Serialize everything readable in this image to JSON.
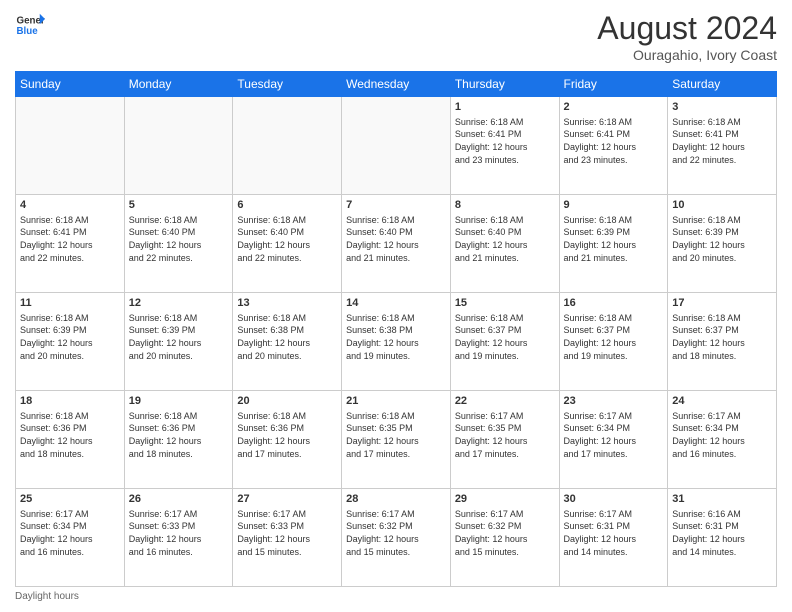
{
  "header": {
    "logo_general": "General",
    "logo_blue": "Blue",
    "title": "August 2024",
    "subtitle": "Ouragahio, Ivory Coast"
  },
  "footer": {
    "note": "Daylight hours"
  },
  "weekdays": [
    "Sunday",
    "Monday",
    "Tuesday",
    "Wednesday",
    "Thursday",
    "Friday",
    "Saturday"
  ],
  "weeks": [
    [
      {
        "day": "",
        "info": ""
      },
      {
        "day": "",
        "info": ""
      },
      {
        "day": "",
        "info": ""
      },
      {
        "day": "",
        "info": ""
      },
      {
        "day": "1",
        "info": "Sunrise: 6:18 AM\nSunset: 6:41 PM\nDaylight: 12 hours\nand 23 minutes."
      },
      {
        "day": "2",
        "info": "Sunrise: 6:18 AM\nSunset: 6:41 PM\nDaylight: 12 hours\nand 23 minutes."
      },
      {
        "day": "3",
        "info": "Sunrise: 6:18 AM\nSunset: 6:41 PM\nDaylight: 12 hours\nand 22 minutes."
      }
    ],
    [
      {
        "day": "4",
        "info": "Sunrise: 6:18 AM\nSunset: 6:41 PM\nDaylight: 12 hours\nand 22 minutes."
      },
      {
        "day": "5",
        "info": "Sunrise: 6:18 AM\nSunset: 6:40 PM\nDaylight: 12 hours\nand 22 minutes."
      },
      {
        "day": "6",
        "info": "Sunrise: 6:18 AM\nSunset: 6:40 PM\nDaylight: 12 hours\nand 22 minutes."
      },
      {
        "day": "7",
        "info": "Sunrise: 6:18 AM\nSunset: 6:40 PM\nDaylight: 12 hours\nand 21 minutes."
      },
      {
        "day": "8",
        "info": "Sunrise: 6:18 AM\nSunset: 6:40 PM\nDaylight: 12 hours\nand 21 minutes."
      },
      {
        "day": "9",
        "info": "Sunrise: 6:18 AM\nSunset: 6:39 PM\nDaylight: 12 hours\nand 21 minutes."
      },
      {
        "day": "10",
        "info": "Sunrise: 6:18 AM\nSunset: 6:39 PM\nDaylight: 12 hours\nand 20 minutes."
      }
    ],
    [
      {
        "day": "11",
        "info": "Sunrise: 6:18 AM\nSunset: 6:39 PM\nDaylight: 12 hours\nand 20 minutes."
      },
      {
        "day": "12",
        "info": "Sunrise: 6:18 AM\nSunset: 6:39 PM\nDaylight: 12 hours\nand 20 minutes."
      },
      {
        "day": "13",
        "info": "Sunrise: 6:18 AM\nSunset: 6:38 PM\nDaylight: 12 hours\nand 20 minutes."
      },
      {
        "day": "14",
        "info": "Sunrise: 6:18 AM\nSunset: 6:38 PM\nDaylight: 12 hours\nand 19 minutes."
      },
      {
        "day": "15",
        "info": "Sunrise: 6:18 AM\nSunset: 6:37 PM\nDaylight: 12 hours\nand 19 minutes."
      },
      {
        "day": "16",
        "info": "Sunrise: 6:18 AM\nSunset: 6:37 PM\nDaylight: 12 hours\nand 19 minutes."
      },
      {
        "day": "17",
        "info": "Sunrise: 6:18 AM\nSunset: 6:37 PM\nDaylight: 12 hours\nand 18 minutes."
      }
    ],
    [
      {
        "day": "18",
        "info": "Sunrise: 6:18 AM\nSunset: 6:36 PM\nDaylight: 12 hours\nand 18 minutes."
      },
      {
        "day": "19",
        "info": "Sunrise: 6:18 AM\nSunset: 6:36 PM\nDaylight: 12 hours\nand 18 minutes."
      },
      {
        "day": "20",
        "info": "Sunrise: 6:18 AM\nSunset: 6:36 PM\nDaylight: 12 hours\nand 17 minutes."
      },
      {
        "day": "21",
        "info": "Sunrise: 6:18 AM\nSunset: 6:35 PM\nDaylight: 12 hours\nand 17 minutes."
      },
      {
        "day": "22",
        "info": "Sunrise: 6:17 AM\nSunset: 6:35 PM\nDaylight: 12 hours\nand 17 minutes."
      },
      {
        "day": "23",
        "info": "Sunrise: 6:17 AM\nSunset: 6:34 PM\nDaylight: 12 hours\nand 17 minutes."
      },
      {
        "day": "24",
        "info": "Sunrise: 6:17 AM\nSunset: 6:34 PM\nDaylight: 12 hours\nand 16 minutes."
      }
    ],
    [
      {
        "day": "25",
        "info": "Sunrise: 6:17 AM\nSunset: 6:34 PM\nDaylight: 12 hours\nand 16 minutes."
      },
      {
        "day": "26",
        "info": "Sunrise: 6:17 AM\nSunset: 6:33 PM\nDaylight: 12 hours\nand 16 minutes."
      },
      {
        "day": "27",
        "info": "Sunrise: 6:17 AM\nSunset: 6:33 PM\nDaylight: 12 hours\nand 15 minutes."
      },
      {
        "day": "28",
        "info": "Sunrise: 6:17 AM\nSunset: 6:32 PM\nDaylight: 12 hours\nand 15 minutes."
      },
      {
        "day": "29",
        "info": "Sunrise: 6:17 AM\nSunset: 6:32 PM\nDaylight: 12 hours\nand 15 minutes."
      },
      {
        "day": "30",
        "info": "Sunrise: 6:17 AM\nSunset: 6:31 PM\nDaylight: 12 hours\nand 14 minutes."
      },
      {
        "day": "31",
        "info": "Sunrise: 6:16 AM\nSunset: 6:31 PM\nDaylight: 12 hours\nand 14 minutes."
      }
    ]
  ]
}
